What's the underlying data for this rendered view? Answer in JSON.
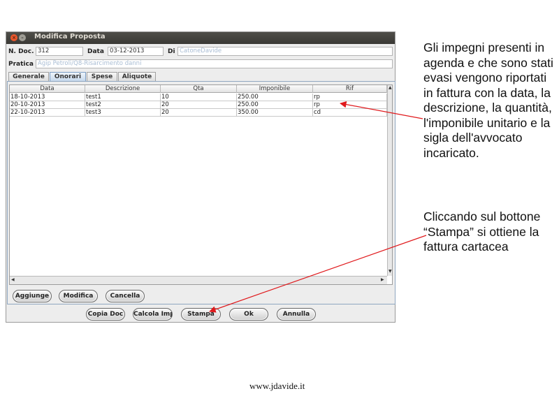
{
  "window": {
    "title": "Modifica Proposta",
    "close_glyph": "×",
    "minimize_glyph": "–"
  },
  "header": {
    "ndoc_label": "N. Doc.",
    "ndoc_value": "312",
    "data_label": "Data",
    "data_value": "03-12-2013",
    "di_label": "Di",
    "di_value": "CatoneDavide",
    "pratica_label": "Pratica",
    "pratica_value": "Agip Petroli/Q8-Risarcimento danni"
  },
  "tabs": [
    "Generale",
    "Onorari",
    "Spese",
    "Aliquote"
  ],
  "active_tab": "Onorari",
  "table": {
    "columns": [
      "Data",
      "Descrizione",
      "Qta",
      "Imponibile",
      "Rif"
    ],
    "rows": [
      [
        "18-10-2013",
        "test1",
        "10",
        "250.00",
        "rp"
      ],
      [
        "20-10-2013",
        "test2",
        "20",
        "250.00",
        "rp"
      ],
      [
        "22-10-2013",
        "test3",
        "20",
        "350.00",
        "cd"
      ]
    ],
    "scroll_up": "▲",
    "scroll_down": "▼",
    "scroll_left": "◀",
    "scroll_right": "▶"
  },
  "panel_buttons": {
    "add": "Aggiunge",
    "edit": "Modifica",
    "delete": "Cancella"
  },
  "footer_buttons": {
    "copy": "Copia Doc",
    "calc": "Calcola Imp",
    "print": "Stampa",
    "ok": "Ok",
    "cancel": "Annulla"
  },
  "notes": {
    "note1": "Gli impegni presenti in agenda e che sono stati evasi vengono riportati in fattura con la data, la descrizione, la quantità, l'imponibile unitario e la sigla dell'avvocato incaricato.",
    "note2": "Cliccando sul bottone “Stampa” si ottiene la fattura cartacea"
  },
  "footer_url": "www.jdavide.it",
  "colors": {
    "arrow": "#e0191c",
    "titlebar": "#3f3e3a",
    "tab_active": "#c6d8ec"
  }
}
